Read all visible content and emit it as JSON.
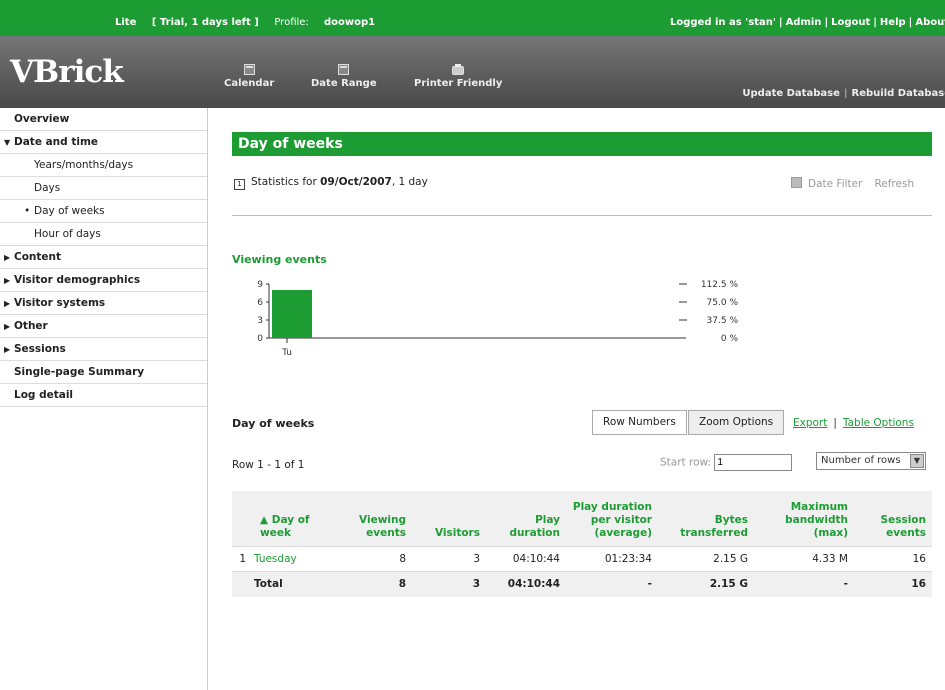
{
  "topbar": {
    "lite": "Lite",
    "trial": "[ Trial, 1 days left ]",
    "profile_label": "Profile:",
    "profile_name": "doowop1",
    "logged_in": "Logged in as 'stan'",
    "admin": "Admin",
    "logout": "Logout",
    "help": "Help",
    "about": "About"
  },
  "header": {
    "logo": "VBrick",
    "calendar": "Calendar",
    "date_range": "Date Range",
    "printer_friendly": "Printer Friendly",
    "update_db": "Update Database",
    "rebuild_db": "Rebuild Database"
  },
  "sidebar": {
    "items": [
      {
        "label": "Overview"
      },
      {
        "label": "Date and time"
      },
      {
        "label": "Years/months/days"
      },
      {
        "label": "Days"
      },
      {
        "label": "Day of weeks"
      },
      {
        "label": "Hour of days"
      },
      {
        "label": "Content"
      },
      {
        "label": "Visitor demographics"
      },
      {
        "label": "Visitor systems"
      },
      {
        "label": "Other"
      },
      {
        "label": "Sessions"
      },
      {
        "label": "Single-page Summary"
      },
      {
        "label": "Log detail"
      }
    ]
  },
  "main": {
    "title": "Day of weeks",
    "stats_prefix": "Statistics for",
    "stats_date": "09/Oct/2007",
    "stats_suffix": ", 1 day",
    "date_filter": "Date Filter",
    "refresh": "Refresh",
    "chart_title": "Viewing events",
    "section_label": "Day of weeks",
    "tab_row_numbers": "Row Numbers",
    "tab_zoom": "Zoom Options",
    "export": "Export",
    "table_options": "Table Options",
    "row_info": "Row 1 - 1 of 1",
    "start_row_label": "Start row:",
    "start_row_value": "1",
    "number_of_rows": "Number of rows"
  },
  "table": {
    "headers": {
      "day": "▲ Day of week",
      "viewing": "Viewing events",
      "visitors": "Visitors",
      "play": "Play duration",
      "ppv": "Play duration per visitor (average)",
      "bytes": "Bytes transferred",
      "maxbw": "Maximum bandwidth (max)",
      "sessions": "Session events"
    },
    "row": {
      "idx": "1",
      "day": "Tuesday",
      "viewing": "8",
      "visitors": "3",
      "play": "04:10:44",
      "ppv": "01:23:34",
      "bytes": "2.15 G",
      "maxbw": "4.33 M",
      "sessions": "16"
    },
    "total": {
      "label": "Total",
      "viewing": "8",
      "visitors": "3",
      "play": "04:10:44",
      "ppv": "-",
      "bytes": "2.15 G",
      "maxbw": "-",
      "sessions": "16"
    }
  },
  "chart_data": {
    "type": "bar",
    "categories": [
      "Tu"
    ],
    "values": [
      8
    ],
    "ylim": [
      0,
      9
    ],
    "yticks": [
      "0",
      "3",
      "6",
      "9"
    ],
    "pct_ticks": [
      "0 %",
      "37.5 %",
      "75.0 %",
      "112.5 %"
    ],
    "color": "#1e9c34"
  }
}
